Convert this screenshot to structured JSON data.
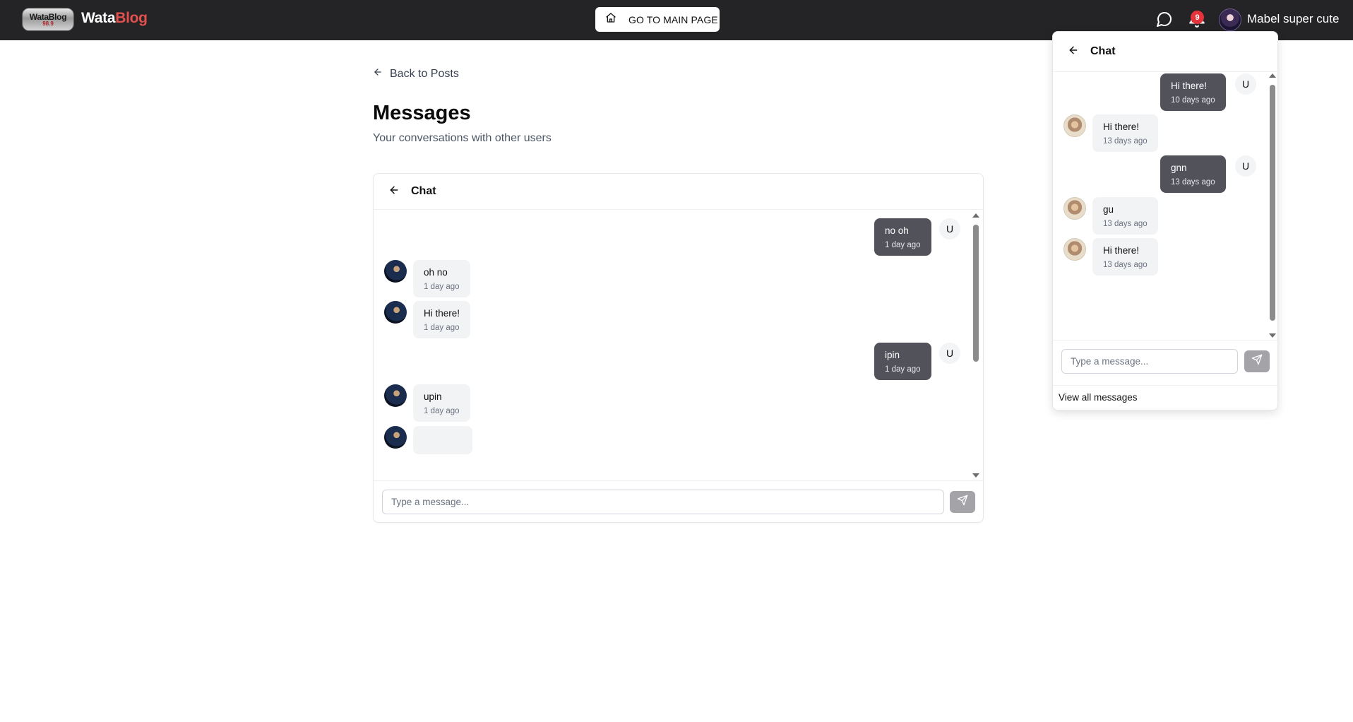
{
  "app": {
    "logo_text_line1": "WataBlog",
    "logo_text_line2": "98.9",
    "brand_part1": "Wata",
    "brand_part2": "Blog",
    "brand_accent_color": "#e3514f",
    "topbar_color": "#242326"
  },
  "topbar": {
    "main_page_button": "GO TO MAIN PAGE",
    "notification_count": "9",
    "user_name": "Mabel super cute"
  },
  "page": {
    "back_link": "Back to Posts",
    "title": "Messages",
    "subtitle": "Your conversations with other users"
  },
  "chat": {
    "title": "Chat",
    "messages": [
      {
        "side": "out",
        "text": "no oh",
        "time": "1 day ago",
        "avatar": "U"
      },
      {
        "side": "in",
        "text": "oh no",
        "time": "1 day ago"
      },
      {
        "side": "in",
        "text": "Hi there!",
        "time": "1 day ago"
      },
      {
        "side": "out",
        "text": "ipin",
        "time": "1 day ago",
        "avatar": "U"
      },
      {
        "side": "in",
        "text": "upin",
        "time": "1 day ago"
      }
    ],
    "input_placeholder": "Type a message..."
  },
  "panel": {
    "title": "Chat",
    "messages": [
      {
        "side": "out",
        "text": "Hi there!",
        "time": "10 days ago",
        "avatar": "U"
      },
      {
        "side": "in",
        "text": "Hi there!",
        "time": "13 days ago"
      },
      {
        "side": "out",
        "text": "gnn",
        "time": "13 days ago",
        "avatar": "U"
      },
      {
        "side": "in",
        "text": "gu",
        "time": "13 days ago"
      },
      {
        "side": "in",
        "text": "Hi there!",
        "time": "13 days ago"
      }
    ],
    "input_placeholder": "Type a message...",
    "view_all": "View all messages"
  },
  "icons": {
    "home": "home-icon",
    "chat": "chat-bubble-icon",
    "bell": "bell-icon",
    "back": "arrow-left-icon",
    "send": "send-icon"
  }
}
